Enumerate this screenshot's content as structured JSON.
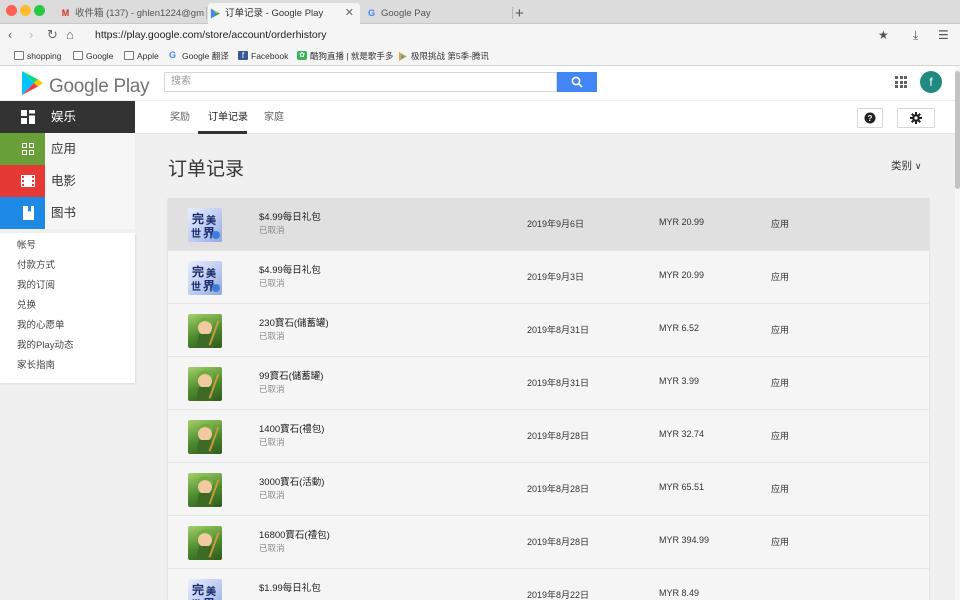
{
  "browser": {
    "tabs": [
      {
        "title": "收件箱 (137) - ghlen1224@gm",
        "icon": "gmail-icon"
      },
      {
        "title": "订单记录 - Google Play",
        "icon": "google-play-icon"
      },
      {
        "title": "Google Pay",
        "icon": "google-g-icon"
      }
    ],
    "url": "https://play.google.com/store/account/orderhistory",
    "bookmarks": [
      {
        "label": "shopping",
        "icon": "folder-icon"
      },
      {
        "label": "Google",
        "icon": "folder-icon"
      },
      {
        "label": "Apple",
        "icon": "folder-icon"
      },
      {
        "label": "Google 翻译",
        "icon": "google-translate-icon"
      },
      {
        "label": "Facebook",
        "icon": "facebook-icon"
      },
      {
        "label": "酷狗直播 | 就是歌手多",
        "icon": "kugou-icon"
      },
      {
        "label": "极限挑战 第5季-腾讯",
        "icon": "tencent-video-icon"
      }
    ]
  },
  "header": {
    "logo_text": "Google Play",
    "search_placeholder": "搜索",
    "avatar_letter": "f"
  },
  "sidebar": {
    "categories": [
      {
        "label": "娱乐",
        "icon": "entertainment-icon",
        "color": "#333333"
      },
      {
        "label": "应用",
        "icon": "apps-icon",
        "color": "#689f38"
      },
      {
        "label": "电影",
        "icon": "movies-icon",
        "color": "#e53935"
      },
      {
        "label": "图书",
        "icon": "books-icon",
        "color": "#1e88e5"
      }
    ],
    "account_links": [
      "帐号",
      "付款方式",
      "我的订阅",
      "兑换",
      "我的心愿单",
      "我的Play动态",
      "家长指南"
    ]
  },
  "subnav": {
    "tabs": [
      "奖励",
      "订单记录",
      "家庭"
    ],
    "active_tab": "订单记录"
  },
  "main": {
    "title": "订单记录",
    "category_filter": "类别"
  },
  "orders": [
    {
      "name": "$4.99每日礼包",
      "status": "已取消",
      "date": "2019年9月6日",
      "price": "MYR 20.99",
      "type": "应用",
      "thumb": "perfect-world-icon"
    },
    {
      "name": "$4.99每日礼包",
      "status": "已取消",
      "date": "2019年9月3日",
      "price": "MYR 20.99",
      "type": "应用",
      "thumb": "perfect-world-icon"
    },
    {
      "name": "230寶石(儲蓄罐)",
      "status": "已取消",
      "date": "2019年8月31日",
      "price": "MYR 6.52",
      "type": "应用",
      "thumb": "castle-clash-icon"
    },
    {
      "name": "99寶石(儲蓄罐)",
      "status": "已取消",
      "date": "2019年8月31日",
      "price": "MYR 3.99",
      "type": "应用",
      "thumb": "castle-clash-icon"
    },
    {
      "name": "1400寶石(禮包)",
      "status": "已取消",
      "date": "2019年8月28日",
      "price": "MYR 32.74",
      "type": "应用",
      "thumb": "castle-clash-icon"
    },
    {
      "name": "3000寶石(活動)",
      "status": "已取消",
      "date": "2019年8月28日",
      "price": "MYR 65.51",
      "type": "应用",
      "thumb": "castle-clash-icon"
    },
    {
      "name": "16800寶石(禮包)",
      "status": "已取消",
      "date": "2019年8月28日",
      "price": "MYR 394.99",
      "type": "应用",
      "thumb": "castle-clash-icon"
    },
    {
      "name": "$1.99每日礼包",
      "status": "",
      "date": "2019年8月22日",
      "price": "MYR 8.49",
      "type": "",
      "thumb": "perfect-world-icon"
    }
  ]
}
